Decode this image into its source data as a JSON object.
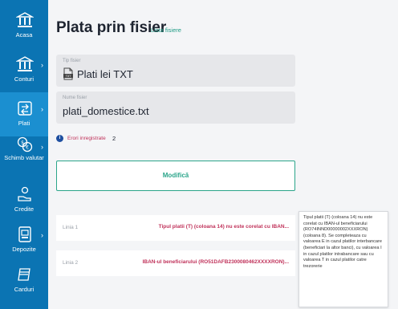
{
  "sidebar": {
    "items": [
      {
        "label": "Acasa",
        "icon": "bank-icon"
      },
      {
        "label": "Conturi",
        "icon": "bank-icon"
      },
      {
        "label": "Plati",
        "icon": "transfer-icon"
      },
      {
        "label": "Schimb valutar",
        "icon": "currency-exchange-icon"
      },
      {
        "label": "Credite",
        "icon": "credit-hand-icon"
      },
      {
        "label": "Depozite",
        "icon": "deposit-icon"
      },
      {
        "label": "Carduri",
        "icon": "card-icon"
      }
    ]
  },
  "header": {
    "title": "Plata prin fisier",
    "files_link": "Lista fisiere"
  },
  "form": {
    "file_type": {
      "label": "Tip fisier",
      "value": "Plati lei TXT"
    },
    "file_name": {
      "label": "Nume fisier",
      "value": "plati_domestice.txt"
    }
  },
  "errors": {
    "icon": "info-icon",
    "label": "Erori inregistrate",
    "count": "2"
  },
  "modify_button": "Modifică",
  "error_rows": [
    {
      "line": "Linia 1",
      "message": "Tipul platii (T) (coloana 14) nu este corelat cu IBAN..."
    },
    {
      "line": "Linia 2",
      "message": "IBAN-ul beneficiarului (RO51DAFB2300080462XXXXRON)..."
    }
  ],
  "tooltip": {
    "text": "Tipul platii (T) (coloana 14) nu este corelat cu IBAN-ul beneficiarului (RO74INND00000002XXXRON) (coloana 8). Se completeaza cu valoarea E in cazul platilor interbancare (beneficiari la altor banci), cu valoarea I in cazul platilor intrabancare sau cu valoarea T in cazul platilor catre trezorerie"
  },
  "colors": {
    "sidebar": "#0b74b3",
    "sidebar_active": "#1b8fd0",
    "accent_green": "#2ba58a",
    "error_red": "#c0325a"
  }
}
